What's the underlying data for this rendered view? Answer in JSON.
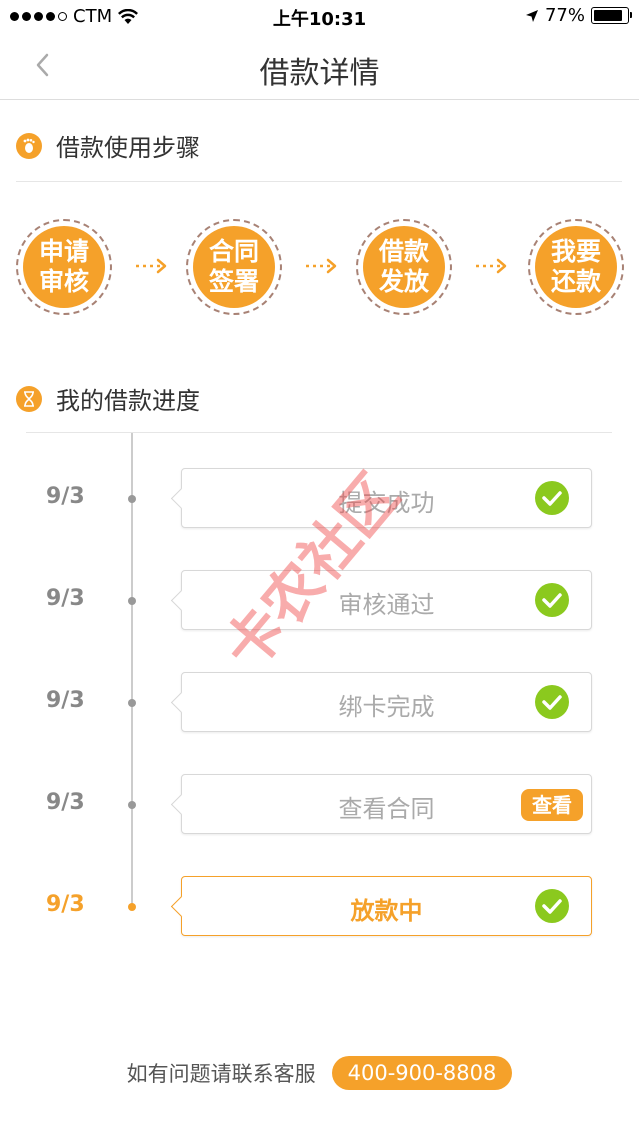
{
  "status_bar": {
    "carrier": "CTM",
    "time": "上午10:31",
    "battery": "77%"
  },
  "nav": {
    "title": "借款详情"
  },
  "steps_section": {
    "title": "借款使用步骤",
    "steps": [
      {
        "line1": "申请",
        "line2": "审核"
      },
      {
        "line1": "合同",
        "line2": "签署"
      },
      {
        "line1": "借款",
        "line2": "发放"
      },
      {
        "line1": "我要",
        "line2": "还款"
      }
    ]
  },
  "progress_section": {
    "title": "我的借款进度",
    "items": [
      {
        "date": "9/3",
        "label": "提交成功",
        "status": "done"
      },
      {
        "date": "9/3",
        "label": "审核通过",
        "status": "done"
      },
      {
        "date": "9/3",
        "label": "绑卡完成",
        "status": "done"
      },
      {
        "date": "9/3",
        "label": "查看合同",
        "status": "view",
        "action_label": "查看"
      },
      {
        "date": "9/3",
        "label": "放款中",
        "status": "active"
      }
    ]
  },
  "watermark": {
    "text": "卡农社区"
  },
  "footer": {
    "text": "如有问题请联系客服",
    "phone": "400-900-8808"
  },
  "colors": {
    "accent": "#f5a12a",
    "check": "#8bc91e"
  }
}
